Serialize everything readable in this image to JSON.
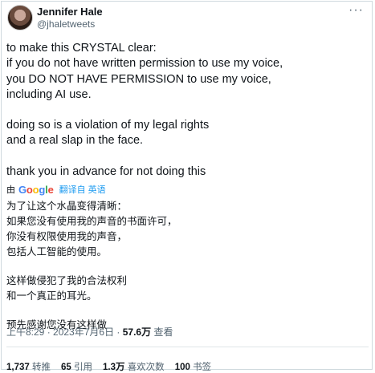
{
  "author": {
    "name": "Jennifer Hale",
    "handle": "@jhaletweets"
  },
  "menu_icon": "more-horizontal-icon",
  "tweet": {
    "paragraphs": [
      [
        "to make this CRYSTAL clear:",
        "if you do not have written permission to use my voice,",
        "you DO NOT HAVE PERMISSION to use my voice,",
        "including AI use."
      ],
      [
        "doing so is a violation of my legal rights",
        "and a real slap in the face."
      ],
      [
        "thank you in advance for not doing this"
      ]
    ]
  },
  "translation_bar": {
    "by": "由",
    "logo": "Google",
    "link": "翻译自 英语"
  },
  "translation": {
    "paragraphs": [
      [
        "为了让这个水晶变得清晰：",
        "如果您没有使用我的声音的书面许可，",
        "你没有权限使用我的声音，",
        "包括人工智能的使用。"
      ],
      [
        "这样做侵犯了我的合法权利",
        "和一个真正的耳光。"
      ],
      [
        "预先感谢您没有这样做"
      ]
    ]
  },
  "meta": {
    "time": "上午8:29",
    "date": "2023年7月6日",
    "views_count": "57.6万",
    "views_label": "查看"
  },
  "stats": [
    {
      "count": "1,737",
      "label": "转推"
    },
    {
      "count": "65",
      "label": "引用"
    },
    {
      "count": "1.3万",
      "label": "喜欢次数"
    },
    {
      "count": "100",
      "label": "书签"
    }
  ]
}
